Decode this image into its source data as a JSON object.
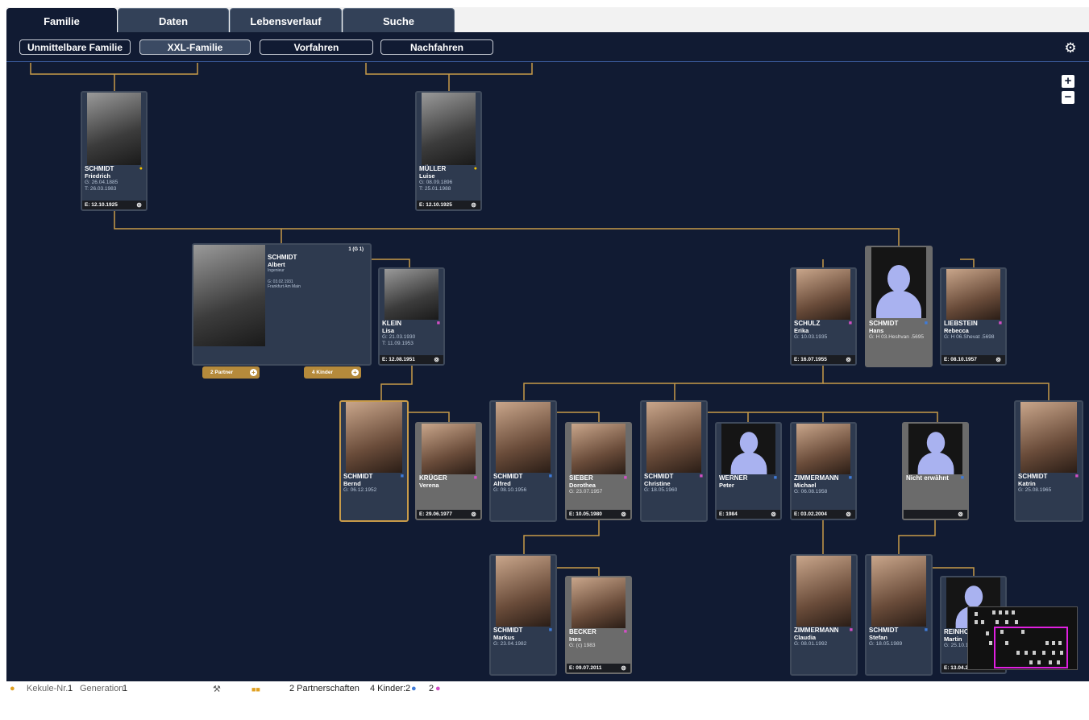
{
  "tabs": [
    {
      "label": "Familie",
      "active": true
    },
    {
      "label": "Daten",
      "active": false
    },
    {
      "label": "Lebensverlauf",
      "active": false
    },
    {
      "label": "Suche",
      "active": false
    }
  ],
  "subtabs": [
    {
      "label": "Unmittelbare Familie",
      "active": false
    },
    {
      "label": "XXL-Familie",
      "active": true
    },
    {
      "label": "Vorfahren",
      "active": false
    },
    {
      "label": "Nachfahren",
      "active": false
    }
  ],
  "icons": {
    "settings": "gear-icon",
    "zoom_in": "plus-icon",
    "zoom_out": "minus-icon"
  },
  "colors": {
    "background": "#111b33",
    "line": "#c89b49",
    "male": "#3f7bd8",
    "female": "#d24fc5",
    "selected": "#c89b49"
  },
  "persons": {
    "friedrich": {
      "last": "SCHMIDT",
      "first": "Friedrich",
      "d1": "G: 26.04.1885",
      "d2": "T: 26.03.1983",
      "foot": "E: 12.10.1925"
    },
    "luise": {
      "last": "MÜLLER",
      "first": "Luise",
      "d1": "G: 08.09.1896",
      "d2": "T: 25.01.1988",
      "foot": "E: 12.10.1925"
    },
    "albert": {
      "last": "SCHMIDT",
      "first": "Albert",
      "occupation": "Ingenieur",
      "d1": "G: 03.02.1931",
      "d2": "Frankfurt Am Main",
      "badge": "1 (G 1)"
    },
    "lisa": {
      "last": "KLEIN",
      "first": "Lisa",
      "d1": "G: 21.03.1930",
      "d2": "T: 11.09.1953",
      "foot": "E: 12.08.1951"
    },
    "erika": {
      "last": "SCHULZ",
      "first": "Erika",
      "d1": "G: 10.03.1935",
      "d2": "",
      "foot": "E: 16.07.1955"
    },
    "hans": {
      "last": "SCHMIDT",
      "first": "Hans",
      "d1": "G: H 03.Heshvan .5695",
      "d2": ""
    },
    "rebecca": {
      "last": "LIEBSTEIN",
      "first": "Rebecca",
      "d1": "G: H 06.Shevat .5698",
      "d2": "",
      "foot": "E: 08.10.1957"
    },
    "bernd": {
      "last": "SCHMIDT",
      "first": "Bernd",
      "d1": "G: 06.12.1952",
      "d2": ""
    },
    "verena": {
      "last": "KRÜGER",
      "first": "Verena",
      "d1": "",
      "d2": "",
      "foot": "E: 29.06.1977"
    },
    "alfred": {
      "last": "SCHMIDT",
      "first": "Alfred",
      "d1": "G: 08.10.1956",
      "d2": ""
    },
    "dorothea": {
      "last": "SIEBER",
      "first": "Dorothea",
      "d1": "G: 23.07.1957",
      "d2": "",
      "foot": "E: 10.05.1980"
    },
    "christine": {
      "last": "SCHMIDT",
      "first": "Christine",
      "d1": "G: 18.05.1960",
      "d2": ""
    },
    "peter": {
      "last": "WERNER",
      "first": "Peter",
      "d1": "",
      "d2": "",
      "foot": "E: 1984"
    },
    "michael": {
      "last": "ZIMMERMANN",
      "first": "Michael",
      "d1": "G: 06.08.1958",
      "d2": "",
      "foot": "E: 03.02.2004"
    },
    "unknown": {
      "last": "Nicht erwähnt",
      "first": "",
      "d1": "",
      "d2": "",
      "foot": ""
    },
    "katrin": {
      "last": "SCHMIDT",
      "first": "Katrin",
      "d1": "G: 25.08.1965",
      "d2": ""
    },
    "markus": {
      "last": "SCHMIDT",
      "first": "Markus",
      "d1": "G: 23.04.1982",
      "d2": ""
    },
    "ines": {
      "last": "BECKER",
      "first": "Ines",
      "d1": "G: (c) 1983",
      "d2": "",
      "foot": "E: 09.07.2011"
    },
    "claudia": {
      "last": "ZIMMERMANN",
      "first": "Claudia",
      "d1": "G: 08.01.1992",
      "d2": ""
    },
    "stefan": {
      "last": "SCHMIDT",
      "first": "Stefan",
      "d1": "G: 18.05.1989",
      "d2": ""
    },
    "martin": {
      "last": "REINHO",
      "first": "Martin",
      "d1": "G: 25.10.1",
      "d2": "",
      "foot": "E: 13.04.20"
    }
  },
  "pills": {
    "partners": "2 Partner",
    "children": "4 Kinder"
  },
  "status": {
    "kekule_label": "Kekule-Nr.",
    "kekule_value": "1",
    "generation_label": "Generation",
    "generation_value": "1",
    "partnerships": "2 Partnerschaften",
    "children_label": "4 Kinder:",
    "children_male": "2",
    "children_female": "2"
  }
}
